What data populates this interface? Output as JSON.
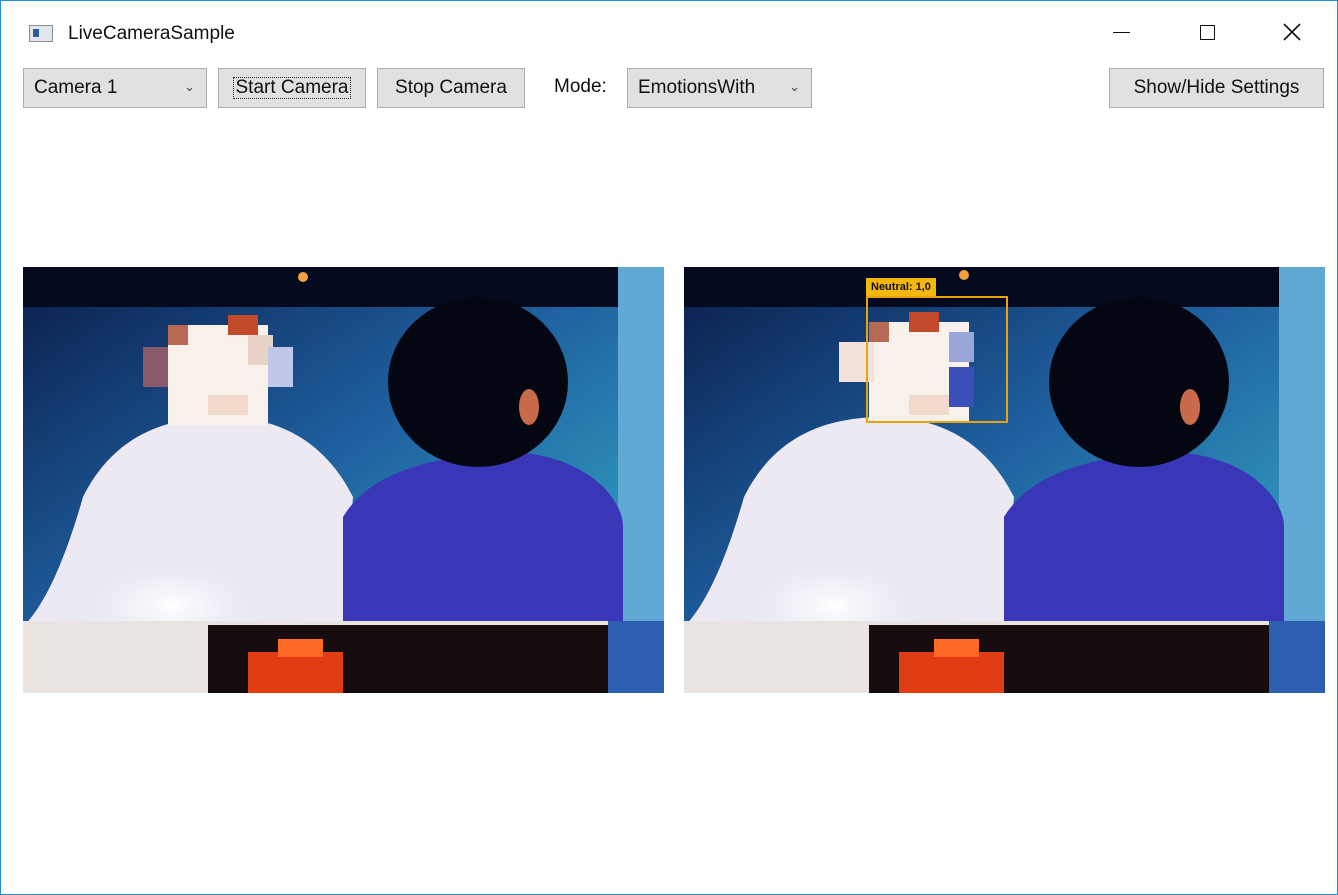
{
  "window": {
    "title": "LiveCameraSample"
  },
  "toolbar": {
    "camera_select": "Camera 1",
    "start_label": "Start Camera",
    "stop_label": "Stop Camera",
    "mode_label": "Mode:",
    "mode_select": "EmotionsWith",
    "settings_label": "Show/Hide Settings"
  },
  "right_panel": {
    "face_label": "Neutral: 1,0"
  },
  "icons": {
    "app": "app-window-icon",
    "minimize": "minimize-icon",
    "maximize": "maximize-icon",
    "close": "close-icon",
    "dropdown": "chevron-down-icon"
  },
  "colors": {
    "window_border": "#1e8fd6",
    "face_box": "#e8a40a",
    "face_label_bg": "#f4b70e"
  }
}
